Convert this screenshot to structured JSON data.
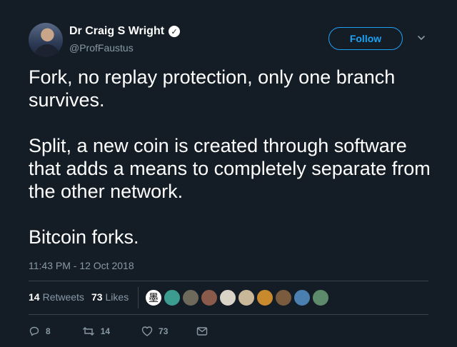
{
  "user": {
    "display_name": "Dr Craig S Wright",
    "verified_badge": "✓",
    "handle": "@ProfFaustus"
  },
  "follow_label": "Follow",
  "tweet": {
    "paragraphs": [
      "Fork, no replay protection, only one branch survives.",
      "Split, a new coin is created through software that adds a means to completely separate from the other network.",
      "Bitcoin forks."
    ],
    "timestamp": "11:43 PM - 12 Oct 2018"
  },
  "stats": {
    "retweets_count": "14",
    "retweets_label": "Retweets",
    "likes_count": "73",
    "likes_label": "Likes"
  },
  "likers": [
    {
      "name": "liker-avatar-1",
      "glyph": "墨",
      "color": "#ffffff"
    },
    {
      "name": "liker-avatar-2",
      "glyph": "",
      "color": "#3b9c8f"
    },
    {
      "name": "liker-avatar-3",
      "glyph": "",
      "color": "#6d6a5c"
    },
    {
      "name": "liker-avatar-4",
      "glyph": "",
      "color": "#8a5a4a"
    },
    {
      "name": "liker-avatar-5",
      "glyph": "",
      "color": "#d9d3c8"
    },
    {
      "name": "liker-avatar-6",
      "glyph": "",
      "color": "#c9b79a"
    },
    {
      "name": "liker-avatar-7",
      "glyph": "",
      "color": "#c98a2e"
    },
    {
      "name": "liker-avatar-8",
      "glyph": "",
      "color": "#7a5b3e"
    },
    {
      "name": "liker-avatar-9",
      "glyph": "",
      "color": "#4a7fb0"
    },
    {
      "name": "liker-avatar-10",
      "glyph": "",
      "color": "#5c8a6a"
    }
  ],
  "actions": {
    "replies": "8",
    "retweets": "14",
    "likes": "73"
  },
  "colors": {
    "background": "#141d26",
    "accent": "#1da1f2",
    "muted": "#8899a6",
    "divider": "#38444d"
  }
}
